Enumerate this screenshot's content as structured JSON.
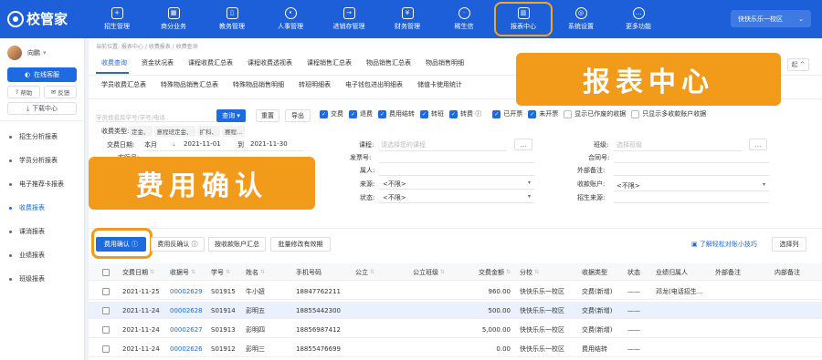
{
  "app": {
    "logo_text": "校管家",
    "campus": "快快乐乐一校区",
    "campus_arrow": "⌄"
  },
  "nav": [
    {
      "label": "招生管理",
      "icon": "user-add-icon"
    },
    {
      "label": "商分业务",
      "icon": "calendar-icon"
    },
    {
      "label": "教务管理",
      "icon": "book-icon"
    },
    {
      "label": "人事管理",
      "icon": "person-icon"
    },
    {
      "label": "进销存管理",
      "icon": "inventory-icon"
    },
    {
      "label": "财务管理",
      "icon": "finance-icon"
    },
    {
      "label": "稀生信",
      "icon": "chat-icon"
    },
    {
      "label": "报表中心",
      "icon": "report-icon"
    },
    {
      "label": "系统设置",
      "icon": "gear-icon"
    },
    {
      "label": "更多功能",
      "icon": "more-icon"
    }
  ],
  "sidebar": {
    "user_name": "向鹏",
    "user_arrow": "▾",
    "online_btn": "在线客服",
    "help_btn": "帮助",
    "mail_btn": "反馈",
    "download_btn": "下载中心",
    "items": [
      {
        "label": "招生分析报表"
      },
      {
        "label": "学员分析报表"
      },
      {
        "label": "电子推荐卡报表"
      },
      {
        "label": "收费报表"
      },
      {
        "label": "课消报表"
      },
      {
        "label": "业绩报表"
      },
      {
        "label": "班级报表"
      }
    ]
  },
  "breadcrumb": "当前位置: 报表中心 / 收费报表 / 收费查询",
  "tabs_row1": [
    "收费查询",
    "资金状况表",
    "课程收费汇总表",
    "课程收费透视表",
    "课程销售汇总表",
    "物品销售汇总表",
    "物品销售明细"
  ],
  "tabs_row2": [
    "学员收费汇总表",
    "特殊物品销售汇总表",
    "特殊物品销售明细",
    "转班明细表",
    "电子钱包进出明细表",
    "储值卡使用统计"
  ],
  "collapse_btn": "起 ^",
  "search": {
    "placeholder": "学员姓名及学号/学号/电话",
    "query_btn": "查询 ▾",
    "reset_btn": "重置",
    "export_btn": "导出"
  },
  "checks": [
    {
      "label": "交费",
      "on": true
    },
    {
      "label": "退费",
      "on": true
    },
    {
      "label": "费用结转",
      "on": true
    },
    {
      "label": "转班",
      "on": true
    },
    {
      "label": "转费 ⓘ",
      "on": true
    },
    {
      "label": "已开票",
      "on": true
    },
    {
      "label": "未开票",
      "on": true
    },
    {
      "label": "显示已作废的收据",
      "on": false
    },
    {
      "label": "只显示多收款账户收据",
      "on": false
    }
  ],
  "filters": {
    "fee_type_label": "收费类型:",
    "fee_type_tags": [
      "定金、",
      "意程班定金、",
      "扩科、",
      "赛程..."
    ],
    "date_label": "交费日期:",
    "date_unit": "本月",
    "date_from": "2021-11-01",
    "date_to_label": "到",
    "date_to": "2021-11-30",
    "course_label": "课程:",
    "course_placeholder": "请选择您的课程",
    "class_label": "班级:",
    "class_placeholder": "选择班级",
    "invoice_label": "发票号:",
    "contract_label": "合同号:",
    "owner_label": "属人:",
    "ext_label": "外部备注:",
    "source_label": "来源:",
    "source_value": "<不限>",
    "account_label": "收款账户:",
    "account_value": "<不限>",
    "status_label": "状态:",
    "status_value": "<不限>",
    "enroll_label": "招生来源:",
    "ellipsis": "...",
    "row2_label": "实际号:"
  },
  "callouts": {
    "report_center": "报表中心",
    "fee_confirm": "费用确认"
  },
  "actions": {
    "confirm": "费用确认 ⓘ",
    "reverse": "费用反确认 ⓘ",
    "account_summary": "按收款账户汇总",
    "batch_edit": "批量修改有效期",
    "tip_link": "了解轻松对账小技巧",
    "select_cols": "选择列"
  },
  "table": {
    "headers": [
      "",
      "交费日期",
      "收据号",
      "学号",
      "姓名",
      "手机号码",
      "公立",
      "公立班级",
      "交费金额",
      "分校",
      "收据类型",
      "状态",
      "业绩归属人",
      "外部备注",
      "内部备注"
    ],
    "rows": [
      [
        "",
        "2021-11-25",
        "00002629",
        "S01915",
        "牛小妞",
        "18847762211",
        "",
        "",
        "960.00",
        "快快乐乐一校区",
        "交费(新增)",
        "——",
        "邓龙(电话招生...",
        "",
        ""
      ],
      [
        "",
        "2021-11-24",
        "00002628",
        "S01914",
        "彭明五",
        "18855442300",
        "",
        "",
        "500.00",
        "快快乐乐一校区",
        "交费(新增)",
        "——",
        "",
        "",
        ""
      ],
      [
        "",
        "2021-11-24",
        "00002627",
        "S01913",
        "彭明四",
        "18856987412",
        "",
        "",
        "5,000.00",
        "快快乐乐一校区",
        "交费(新增)",
        "——",
        "",
        "",
        ""
      ],
      [
        "",
        "2021-11-24",
        "00002626",
        "S01912",
        "彭明三",
        "18855476699",
        "",
        "",
        "0.00",
        "快快乐乐一校区",
        "费用结转",
        "——",
        "",
        "",
        ""
      ]
    ]
  }
}
